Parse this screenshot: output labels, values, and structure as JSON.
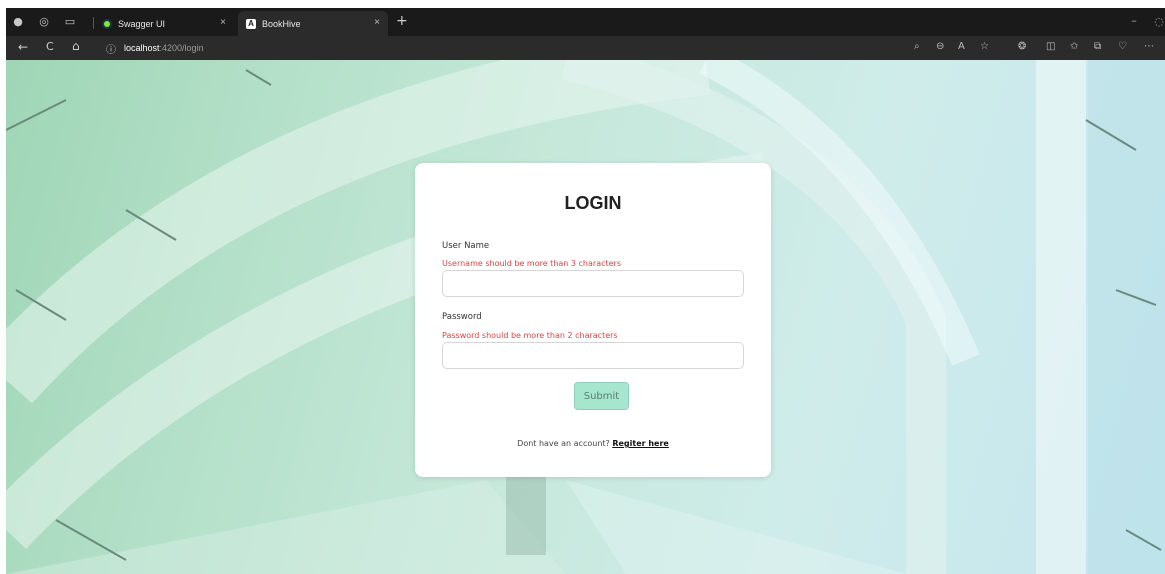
{
  "browser": {
    "tabs": [
      {
        "title": "Swagger UI",
        "close": "×",
        "active": false
      },
      {
        "title": "BookHive",
        "close": "×",
        "active": true
      }
    ],
    "new_tab": "+",
    "address": {
      "host": "localhost",
      "path": ":4200/login"
    },
    "window_controls": {
      "minimize": "–"
    },
    "icons": {
      "back": "←",
      "refresh": "C",
      "home": "⌂",
      "info": "ⓘ",
      "search": "⌕",
      "zoom": "⊖",
      "read_aloud": "A",
      "favorite": "☆",
      "copilot": "❂",
      "split": "◫",
      "favorites": "✩",
      "collections": "⧉",
      "extensions": "♡",
      "more": "⋯"
    }
  },
  "login": {
    "title": "LOGIN",
    "username": {
      "label": "User Name",
      "error": "Username should be more than 3 characters",
      "value": ""
    },
    "password": {
      "label": "Password",
      "error": "Password should be more than 2 characters",
      "value": ""
    },
    "submit_label": "Submit",
    "footer_prompt": "Dont have an account?",
    "register_link": "Regiter here"
  },
  "colors": {
    "error": "#d64545",
    "submit_bg": "#a6e6cf",
    "chrome_bg": "#1f1f1f"
  }
}
